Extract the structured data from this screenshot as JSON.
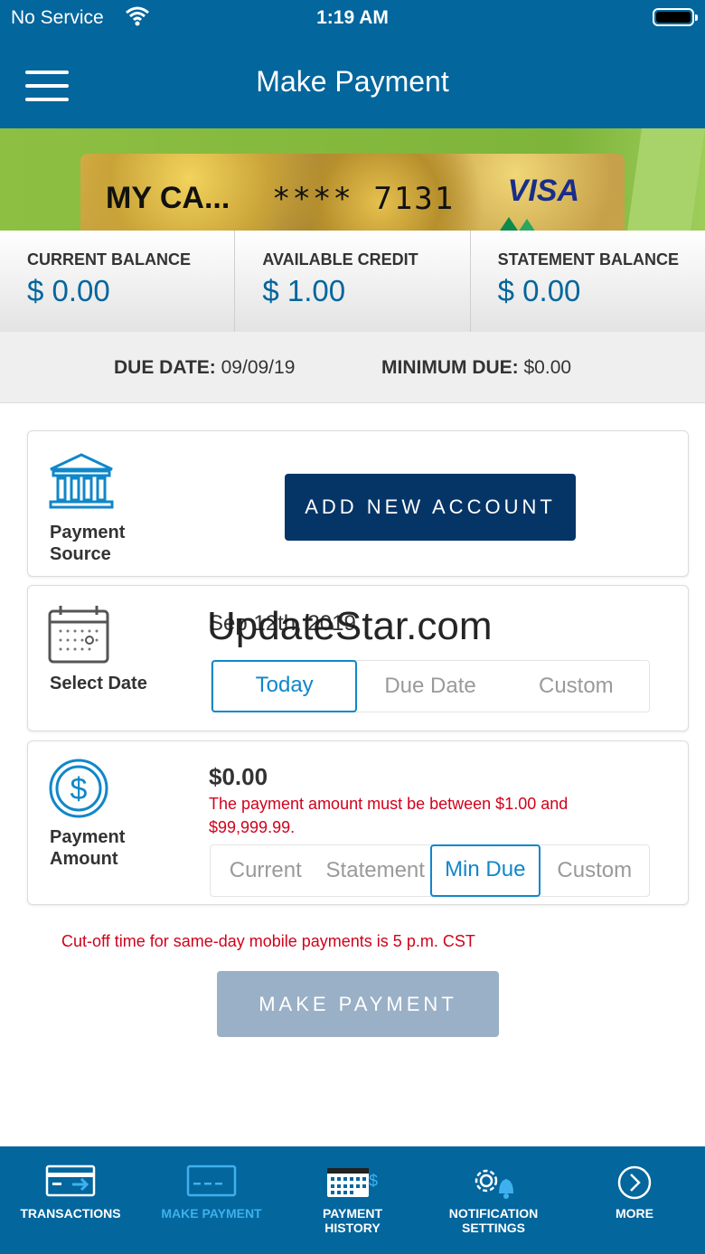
{
  "status_bar": {
    "carrier": "No Service",
    "time": "1:19 AM"
  },
  "header": {
    "title": "Make Payment"
  },
  "card": {
    "name": "MY CA...",
    "number": "**** 7131",
    "brand": "VISA"
  },
  "balances": [
    {
      "label": "CURRENT BALANCE",
      "value": "$ 0.00"
    },
    {
      "label": "AVAILABLE CREDIT",
      "value": "$ 1.00"
    },
    {
      "label": "STATEMENT BALANCE",
      "value": "$ 0.00"
    }
  ],
  "due": {
    "due_label": "DUE DATE:",
    "due_value": "09/09/19",
    "min_label": "MINIMUM DUE:",
    "min_value": "$0.00"
  },
  "payment_source": {
    "label_line1": "Payment",
    "label_line2": "Source",
    "button": "ADD NEW ACCOUNT"
  },
  "select_date": {
    "label": "Select Date",
    "date": "Sep 12th, 2019",
    "options": [
      "Today",
      "Due Date",
      "Custom"
    ],
    "selected": "Today"
  },
  "watermark": "UpdateStar.com",
  "payment_amount": {
    "label_line1": "Payment",
    "label_line2": "Amount",
    "amount": "$0.00",
    "error": "The payment amount must be between $1.00 and $99,999.99.",
    "options": [
      "Current",
      "Statement",
      "Min Due",
      "Custom"
    ],
    "selected": "Min Due"
  },
  "cutoff_notice": "Cut-off time for same-day mobile payments is 5 p.m. CST",
  "make_payment_button": "MAKE PAYMENT",
  "bottom_nav": [
    {
      "line1": "TRANSACTIONS",
      "line2": "",
      "icon": "credit-card-arrow-icon"
    },
    {
      "line1": "MAKE PAYMENT",
      "line2": "",
      "icon": "credit-card-icon",
      "active": true
    },
    {
      "line1": "PAYMENT",
      "line2": "HISTORY",
      "icon": "calendar-dollar-icon"
    },
    {
      "line1": "NOTIFICATION",
      "line2": "SETTINGS",
      "icon": "gear-bell-icon"
    },
    {
      "line1": "MORE",
      "line2": "",
      "icon": "chevron-right-circle-icon"
    }
  ],
  "colors": {
    "header": "#03669d",
    "primary_button": "#053567",
    "accent": "#1087c9",
    "error": "#d0021b",
    "nav_active": "#3fb0ee"
  }
}
